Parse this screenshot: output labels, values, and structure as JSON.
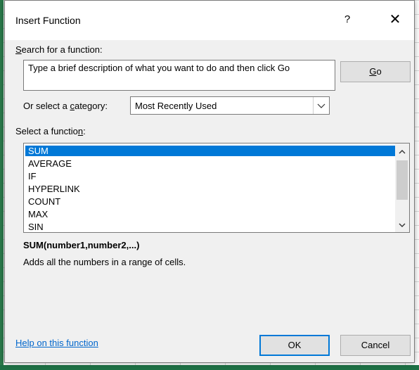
{
  "dialog": {
    "title": "Insert Function",
    "help_glyph": "?",
    "close_glyph": "✕"
  },
  "search": {
    "label_accel": "S",
    "label_rest": "earch for a function:",
    "value": "Type a brief description of what you want to do and then click Go",
    "go_accel": "G",
    "go_rest": "o"
  },
  "category": {
    "label_before": "Or select a ",
    "label_accel": "c",
    "label_after": "ategory:",
    "selected": "Most Recently Used"
  },
  "functions": {
    "label_before": "Select a functio",
    "label_accel": "n",
    "label_after": ":",
    "items": [
      "SUM",
      "AVERAGE",
      "IF",
      "HYPERLINK",
      "COUNT",
      "MAX",
      "SIN"
    ],
    "selected_index": 0,
    "signature": "SUM(number1,number2,...)",
    "description": "Adds all the numbers in a range of cells."
  },
  "footer": {
    "help_link": "Help on this function",
    "ok_label": "OK",
    "cancel_label": "Cancel"
  },
  "colors": {
    "selection": "#0078d7",
    "link": "#0066cc",
    "excel_green": "#1e7145"
  },
  "icons": {
    "help": "question-icon",
    "close": "close-icon",
    "dropdown": "chevron-down-icon",
    "scroll_up": "chevron-up-icon",
    "scroll_down": "chevron-down-icon"
  }
}
